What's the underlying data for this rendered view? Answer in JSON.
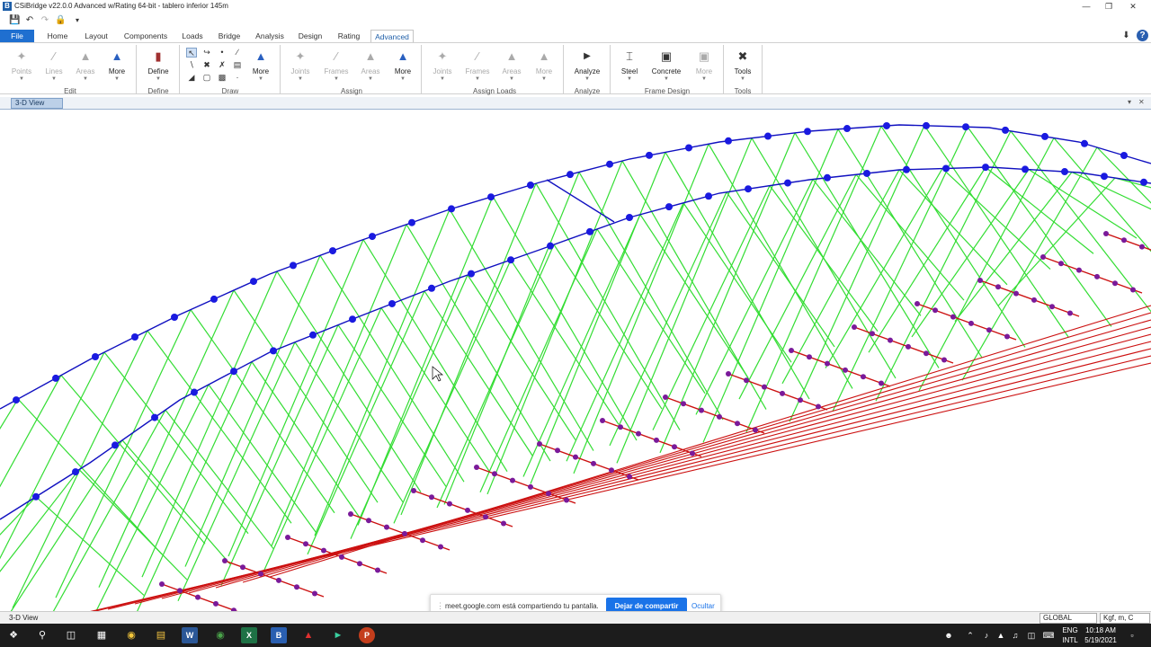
{
  "window": {
    "title": "CSiBridge v22.0.0 Advanced w/Rating 64-bit - tablero inferior 145m",
    "app_icon_letter": "B"
  },
  "menu_tabs": [
    "File",
    "Home",
    "Layout",
    "Components",
    "Loads",
    "Bridge",
    "Analysis",
    "Design",
    "Rating",
    "Advanced"
  ],
  "ribbon": {
    "buttons": {
      "points": "Points",
      "lines": "Lines",
      "areas": "Areas",
      "more_edit": "More",
      "define": "Define",
      "more_draw": "More",
      "joints": "Joints",
      "frames": "Frames",
      "areas_assign": "Areas",
      "more_assign": "More",
      "joints_loads": "Joints",
      "frames_loads": "Frames",
      "areas_loads": "Areas",
      "more_loads": "More",
      "analyze": "Analyze",
      "steel": "Steel",
      "concrete": "Concrete",
      "more_design": "More",
      "tools": "Tools"
    },
    "groups": {
      "edit": "Edit",
      "define": "Define",
      "draw": "Draw",
      "assign": "Assign",
      "assign_loads": "Assign Loads",
      "analyze": "Analyze",
      "frame_design": "Frame Design",
      "tools": "Tools"
    }
  },
  "view_tab": "3-D View",
  "status": {
    "view_label": "3-D View",
    "coord_system": "GLOBAL",
    "units": "Kgf, m, C"
  },
  "screen_share": {
    "message": "meet.google.com está compartiendo tu pantalla.",
    "stop_label": "Dejar de compartir",
    "hide_label": "Ocultar"
  },
  "taskbar": {
    "lang_top": "ENG",
    "lang_bottom": "INTL",
    "time": "10:18 AM",
    "date": "5/19/2021"
  },
  "colors": {
    "arch": "#1010c0",
    "hanger": "#33dd33",
    "deck": "#cc1111",
    "node_blue": "#1a1ae0",
    "node_purple": "#7a1a9a",
    "accent": "#1f6fd0"
  }
}
